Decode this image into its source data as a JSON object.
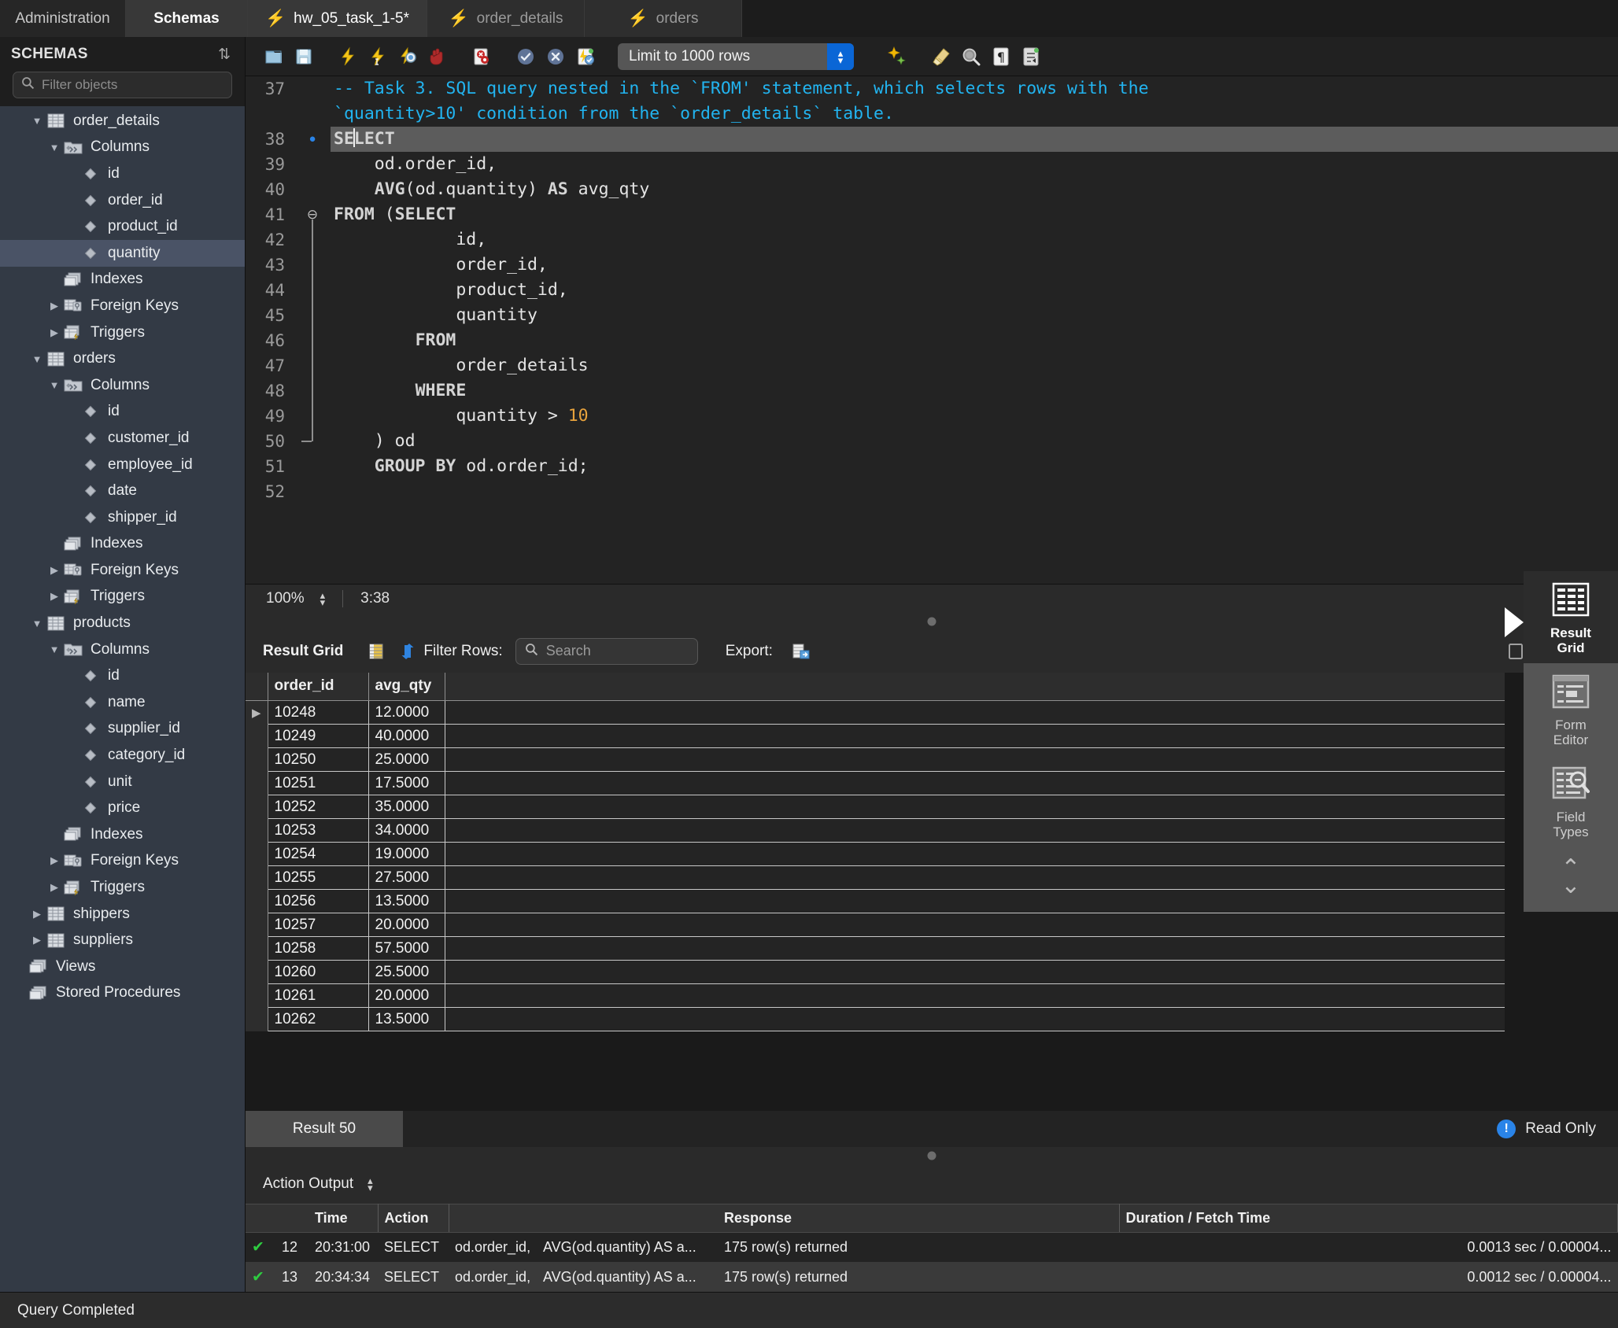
{
  "tabs": {
    "left_panels": [
      {
        "label": "Administration",
        "active": false
      },
      {
        "label": "Schemas",
        "active": true
      }
    ],
    "editors": [
      {
        "label": "hw_05_task_1-5*",
        "active": true
      },
      {
        "label": "order_details",
        "active": false
      },
      {
        "label": "orders",
        "active": false
      }
    ]
  },
  "sidebar": {
    "title": "SCHEMAS",
    "refresh_icon": "refresh-icon",
    "filter": {
      "placeholder": "Filter objects",
      "icon": "search-icon"
    },
    "tree": [
      {
        "label": "order_details",
        "depth": 1,
        "twisty": "open",
        "icon": "table-icon",
        "selected": false
      },
      {
        "label": "Columns",
        "depth": 2,
        "twisty": "open",
        "icon": "columns-icon",
        "selected": false
      },
      {
        "label": "id",
        "depth": 3,
        "twisty": "none",
        "icon": "field-icon",
        "selected": false
      },
      {
        "label": "order_id",
        "depth": 3,
        "twisty": "none",
        "icon": "field-icon",
        "selected": false
      },
      {
        "label": "product_id",
        "depth": 3,
        "twisty": "none",
        "icon": "field-icon",
        "selected": false
      },
      {
        "label": "quantity",
        "depth": 3,
        "twisty": "none",
        "icon": "field-icon",
        "selected": true
      },
      {
        "label": "Indexes",
        "depth": 2,
        "twisty": "none",
        "icon": "folder-icon",
        "selected": false
      },
      {
        "label": "Foreign Keys",
        "depth": 2,
        "twisty": "closed",
        "icon": "fk-icon",
        "selected": false
      },
      {
        "label": "Triggers",
        "depth": 2,
        "twisty": "closed",
        "icon": "trigger-icon",
        "selected": false
      },
      {
        "label": "orders",
        "depth": 1,
        "twisty": "open",
        "icon": "table-icon",
        "selected": false
      },
      {
        "label": "Columns",
        "depth": 2,
        "twisty": "open",
        "icon": "columns-icon",
        "selected": false
      },
      {
        "label": "id",
        "depth": 3,
        "twisty": "none",
        "icon": "field-icon",
        "selected": false
      },
      {
        "label": "customer_id",
        "depth": 3,
        "twisty": "none",
        "icon": "field-icon",
        "selected": false
      },
      {
        "label": "employee_id",
        "depth": 3,
        "twisty": "none",
        "icon": "field-icon",
        "selected": false
      },
      {
        "label": "date",
        "depth": 3,
        "twisty": "none",
        "icon": "field-icon",
        "selected": false
      },
      {
        "label": "shipper_id",
        "depth": 3,
        "twisty": "none",
        "icon": "field-icon",
        "selected": false
      },
      {
        "label": "Indexes",
        "depth": 2,
        "twisty": "none",
        "icon": "folder-icon",
        "selected": false
      },
      {
        "label": "Foreign Keys",
        "depth": 2,
        "twisty": "closed",
        "icon": "fk-icon",
        "selected": false
      },
      {
        "label": "Triggers",
        "depth": 2,
        "twisty": "closed",
        "icon": "trigger-icon",
        "selected": false
      },
      {
        "label": "products",
        "depth": 1,
        "twisty": "open",
        "icon": "table-icon",
        "selected": false
      },
      {
        "label": "Columns",
        "depth": 2,
        "twisty": "open",
        "icon": "columns-icon",
        "selected": false
      },
      {
        "label": "id",
        "depth": 3,
        "twisty": "none",
        "icon": "field-icon",
        "selected": false
      },
      {
        "label": "name",
        "depth": 3,
        "twisty": "none",
        "icon": "field-icon",
        "selected": false
      },
      {
        "label": "supplier_id",
        "depth": 3,
        "twisty": "none",
        "icon": "field-icon",
        "selected": false
      },
      {
        "label": "category_id",
        "depth": 3,
        "twisty": "none",
        "icon": "field-icon",
        "selected": false
      },
      {
        "label": "unit",
        "depth": 3,
        "twisty": "none",
        "icon": "field-icon",
        "selected": false
      },
      {
        "label": "price",
        "depth": 3,
        "twisty": "none",
        "icon": "field-icon",
        "selected": false
      },
      {
        "label": "Indexes",
        "depth": 2,
        "twisty": "none",
        "icon": "folder-icon",
        "selected": false
      },
      {
        "label": "Foreign Keys",
        "depth": 2,
        "twisty": "closed",
        "icon": "fk-icon",
        "selected": false
      },
      {
        "label": "Triggers",
        "depth": 2,
        "twisty": "closed",
        "icon": "trigger-icon",
        "selected": false
      },
      {
        "label": "shippers",
        "depth": 1,
        "twisty": "closed",
        "icon": "table-icon",
        "selected": false
      },
      {
        "label": "suppliers",
        "depth": 1,
        "twisty": "closed",
        "icon": "table-icon",
        "selected": false
      },
      {
        "label": "Views",
        "depth": 0,
        "twisty": "none",
        "icon": "folder-icon",
        "selected": false
      },
      {
        "label": "Stored Procedures",
        "depth": 0,
        "twisty": "none",
        "icon": "folder-icon",
        "selected": false
      }
    ]
  },
  "toolbar": {
    "icons": [
      "open-sql-file-icon",
      "save-sql-file-icon",
      "execute-icon",
      "execute-current-statement-icon",
      "explain-icon",
      "stop-icon",
      "toggle-stop-on-error-icon",
      "commit-icon",
      "rollback-icon",
      "autocommit-icon"
    ],
    "limit_value": "Limit to 1000 rows",
    "right_icons": [
      "beautify-sql-icon",
      "clear-context-icon",
      "find-icon",
      "invisible-chars-icon",
      "wrap-lines-icon"
    ]
  },
  "editor": {
    "lines": [
      {
        "num": "37",
        "mark": "",
        "fold": "",
        "html": "<span class='cm'>-- Task 3. SQL query nested in the `FROM' statement, which selects rows with the</span>"
      },
      {
        "num": "",
        "mark": "",
        "fold": "",
        "html": "<span class='cm'>`quantity&gt;10' condition from the `order_details` table.</span>",
        "wrapped": true
      },
      {
        "num": "38",
        "mark": "dot",
        "fold": "",
        "html": "<span class='k'>SE</span><span class='caret'></span><span class='k'>LECT</span>",
        "highlight": true
      },
      {
        "num": "39",
        "mark": "",
        "fold": "",
        "html": "    od.order_id,"
      },
      {
        "num": "40",
        "mark": "",
        "fold": "",
        "html": "    <span class='k'>AVG</span>(od.quantity) <span class='k'>AS</span> avg_qty"
      },
      {
        "num": "41",
        "mark": "",
        "fold": "minus",
        "html": "<span class='k'>FROM</span> (<span class='k'>SELECT</span>"
      },
      {
        "num": "42",
        "mark": "",
        "fold": "",
        "html": "            id,"
      },
      {
        "num": "43",
        "mark": "",
        "fold": "",
        "html": "            order_id,"
      },
      {
        "num": "44",
        "mark": "",
        "fold": "",
        "html": "            product_id,"
      },
      {
        "num": "45",
        "mark": "",
        "fold": "",
        "html": "            quantity"
      },
      {
        "num": "46",
        "mark": "",
        "fold": "",
        "html": "        <span class='k'>FROM</span>"
      },
      {
        "num": "47",
        "mark": "",
        "fold": "",
        "html": "            order_details"
      },
      {
        "num": "48",
        "mark": "",
        "fold": "",
        "html": "        <span class='k'>WHERE</span>"
      },
      {
        "num": "49",
        "mark": "",
        "fold": "",
        "html": "            quantity &gt; <span class='num'>10</span>"
      },
      {
        "num": "50",
        "mark": "",
        "fold": "end",
        "html": "    ) od"
      },
      {
        "num": "51",
        "mark": "",
        "fold": "",
        "html": "    <span class='k'>GROUP BY</span> od.order_id;"
      },
      {
        "num": "52",
        "mark": "",
        "fold": "",
        "html": ""
      }
    ],
    "zoom": "100%",
    "cursor_position": "3:38"
  },
  "result_toolbar": {
    "title": "Result Grid",
    "grid_icon": "grid-view-icon",
    "refresh_icon": "refresh-result-icon",
    "filter_label": "Filter Rows:",
    "search_placeholder": "Search",
    "search_icon": "search-icon",
    "export_label": "Export:",
    "export_icon": "export-recordset-icon",
    "fetch_icon": "fetch-rows-icon"
  },
  "result_grid": {
    "columns": [
      "order_id",
      "avg_qty"
    ],
    "rows": [
      {
        "order_id": "10248",
        "avg_qty": "12.0000",
        "current": true
      },
      {
        "order_id": "10249",
        "avg_qty": "40.0000",
        "current": false
      },
      {
        "order_id": "10250",
        "avg_qty": "25.0000",
        "current": false
      },
      {
        "order_id": "10251",
        "avg_qty": "17.5000",
        "current": false
      },
      {
        "order_id": "10252",
        "avg_qty": "35.0000",
        "current": false
      },
      {
        "order_id": "10253",
        "avg_qty": "34.0000",
        "current": false
      },
      {
        "order_id": "10254",
        "avg_qty": "19.0000",
        "current": false
      },
      {
        "order_id": "10255",
        "avg_qty": "27.5000",
        "current": false
      },
      {
        "order_id": "10256",
        "avg_qty": "13.5000",
        "current": false
      },
      {
        "order_id": "10257",
        "avg_qty": "20.0000",
        "current": false
      },
      {
        "order_id": "10258",
        "avg_qty": "57.5000",
        "current": false
      },
      {
        "order_id": "10260",
        "avg_qty": "25.5000",
        "current": false
      },
      {
        "order_id": "10261",
        "avg_qty": "20.0000",
        "current": false
      },
      {
        "order_id": "10262",
        "avg_qty": "13.5000",
        "current": false
      }
    ],
    "tab_label": "Result 50",
    "readonly_label": "Read Only",
    "readonly_badge": "!"
  },
  "right_panel": {
    "items": [
      {
        "label_line1": "Result",
        "label_line2": "Grid",
        "icon": "result-grid-icon",
        "active": true
      },
      {
        "label_line1": "Form",
        "label_line2": "Editor",
        "icon": "form-editor-icon",
        "active": false
      },
      {
        "label_line1": "Field",
        "label_line2": "Types",
        "icon": "field-types-icon",
        "active": false
      }
    ],
    "updown_icon": "collapse-expand-icon"
  },
  "action_output": {
    "title": "Action Output",
    "columns": [
      "",
      "",
      "Time",
      "Action",
      "Response",
      "Duration / Fetch Time"
    ],
    "rows": [
      {
        "status": "success",
        "index": "12",
        "time": "20:31:00",
        "action1": "SELECT",
        "action2": "od.order_id,",
        "action3": "AVG(od.quantity) AS a...",
        "response": "175 row(s) returned",
        "duration": "0.0013 sec / 0.00004..."
      },
      {
        "status": "success",
        "index": "13",
        "time": "20:34:34",
        "action1": "SELECT",
        "action2": "od.order_id,",
        "action3": "AVG(od.quantity) AS a...",
        "response": "175 row(s) returned",
        "duration": "0.0012 sec / 0.00004..."
      }
    ]
  },
  "status_bar": {
    "text": "Query Completed"
  },
  "colors": {
    "sidebar_bg": "#333a45",
    "selection": "#4a5366",
    "accent_blue": "#2a84e8",
    "comment": "#22b4f0",
    "number": "#e8a33d",
    "success_green": "#2ecc40"
  }
}
